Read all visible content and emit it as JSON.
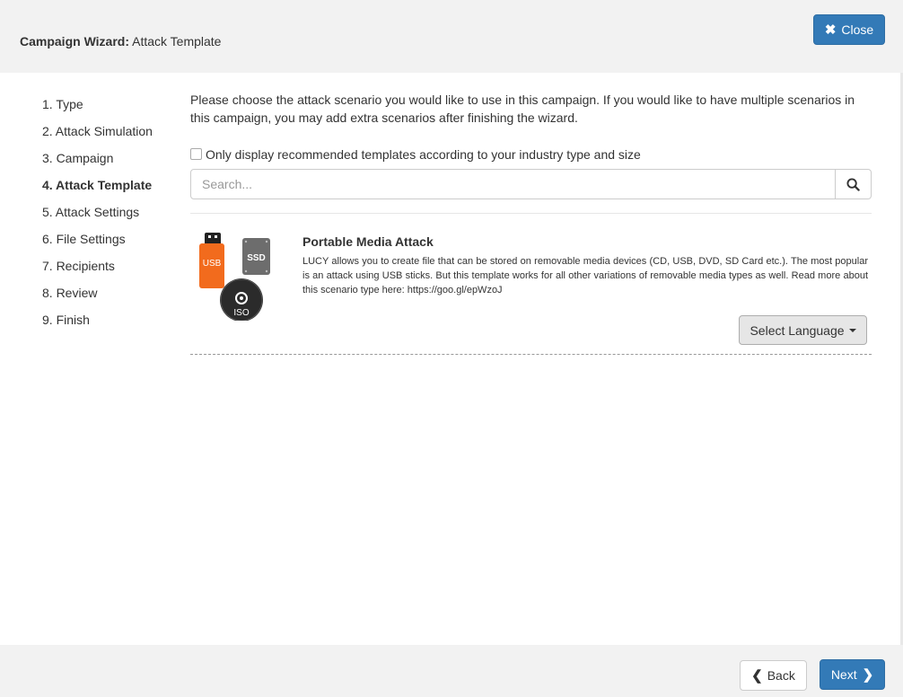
{
  "header": {
    "title_bold": "Campaign Wizard:",
    "title_rest": "Attack Template",
    "close_label": "Close"
  },
  "steps": [
    {
      "label": "1. Type",
      "active": false
    },
    {
      "label": "2. Attack Simulation",
      "active": false
    },
    {
      "label": "3. Campaign",
      "active": false
    },
    {
      "label": "4. Attack Template",
      "active": true
    },
    {
      "label": "5. Attack Settings",
      "active": false
    },
    {
      "label": "6. File Settings",
      "active": false
    },
    {
      "label": "7. Recipients",
      "active": false
    },
    {
      "label": "8. Review",
      "active": false
    },
    {
      "label": "9. Finish",
      "active": false
    }
  ],
  "main": {
    "intro": "Please choose the attack scenario you would like to use in this campaign. If you would like to have multiple scenarios in this campaign, you may add extra scenarios after finishing the wizard.",
    "checkbox_label": "Only display recommended templates according to your industry type and size",
    "search_placeholder": "Search..."
  },
  "template": {
    "title": "Portable Media Attack",
    "description": "LUCY allows you to create file that can be stored on removable media devices (CD, USB, DVD, SD Card etc.). The most popular is an attack using USB sticks. But this template works for all other variations of removable media types as well. Read more about this scenario type here: https://goo.gl/epWzoJ",
    "icon_labels": {
      "usb": "USB",
      "ssd": "SSD",
      "iso": "ISO"
    },
    "select_language_label": "Select Language"
  },
  "footer": {
    "back_label": "Back",
    "next_label": "Next"
  },
  "colors": {
    "primary": "#337ab7",
    "usb_orange": "#f26b1d",
    "header_bg": "#f2f2f2"
  }
}
